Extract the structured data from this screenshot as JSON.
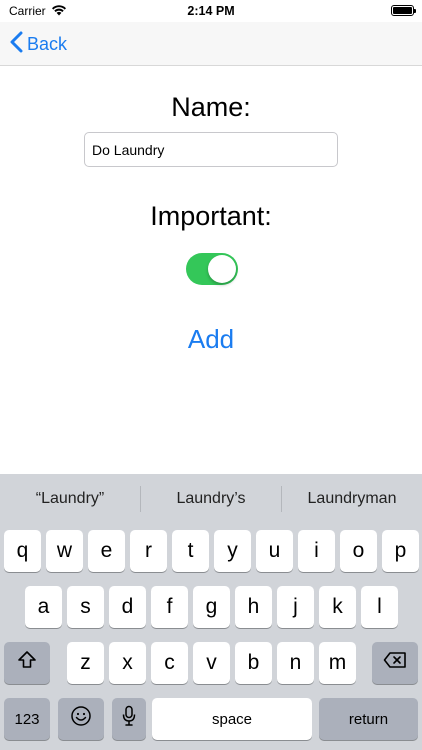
{
  "status_bar": {
    "carrier": "Carrier",
    "time": "2:14 PM"
  },
  "nav": {
    "back_label": "Back"
  },
  "form": {
    "name_label": "Name:",
    "name_value": "Do Laundry",
    "important_label": "Important:",
    "important_on": true,
    "add_label": "Add"
  },
  "keyboard": {
    "suggestions": [
      "“Laundry”",
      "Laundry’s",
      "Laundryman"
    ],
    "row1": [
      "q",
      "w",
      "e",
      "r",
      "t",
      "y",
      "u",
      "i",
      "o",
      "p"
    ],
    "row2": [
      "a",
      "s",
      "d",
      "f",
      "g",
      "h",
      "j",
      "k",
      "l"
    ],
    "row3": [
      "z",
      "x",
      "c",
      "v",
      "b",
      "n",
      "m"
    ],
    "numbers_label": "123",
    "space_label": "space",
    "return_label": "return"
  },
  "colors": {
    "accent": "#1a7cf0",
    "toggle_on": "#34c759"
  }
}
